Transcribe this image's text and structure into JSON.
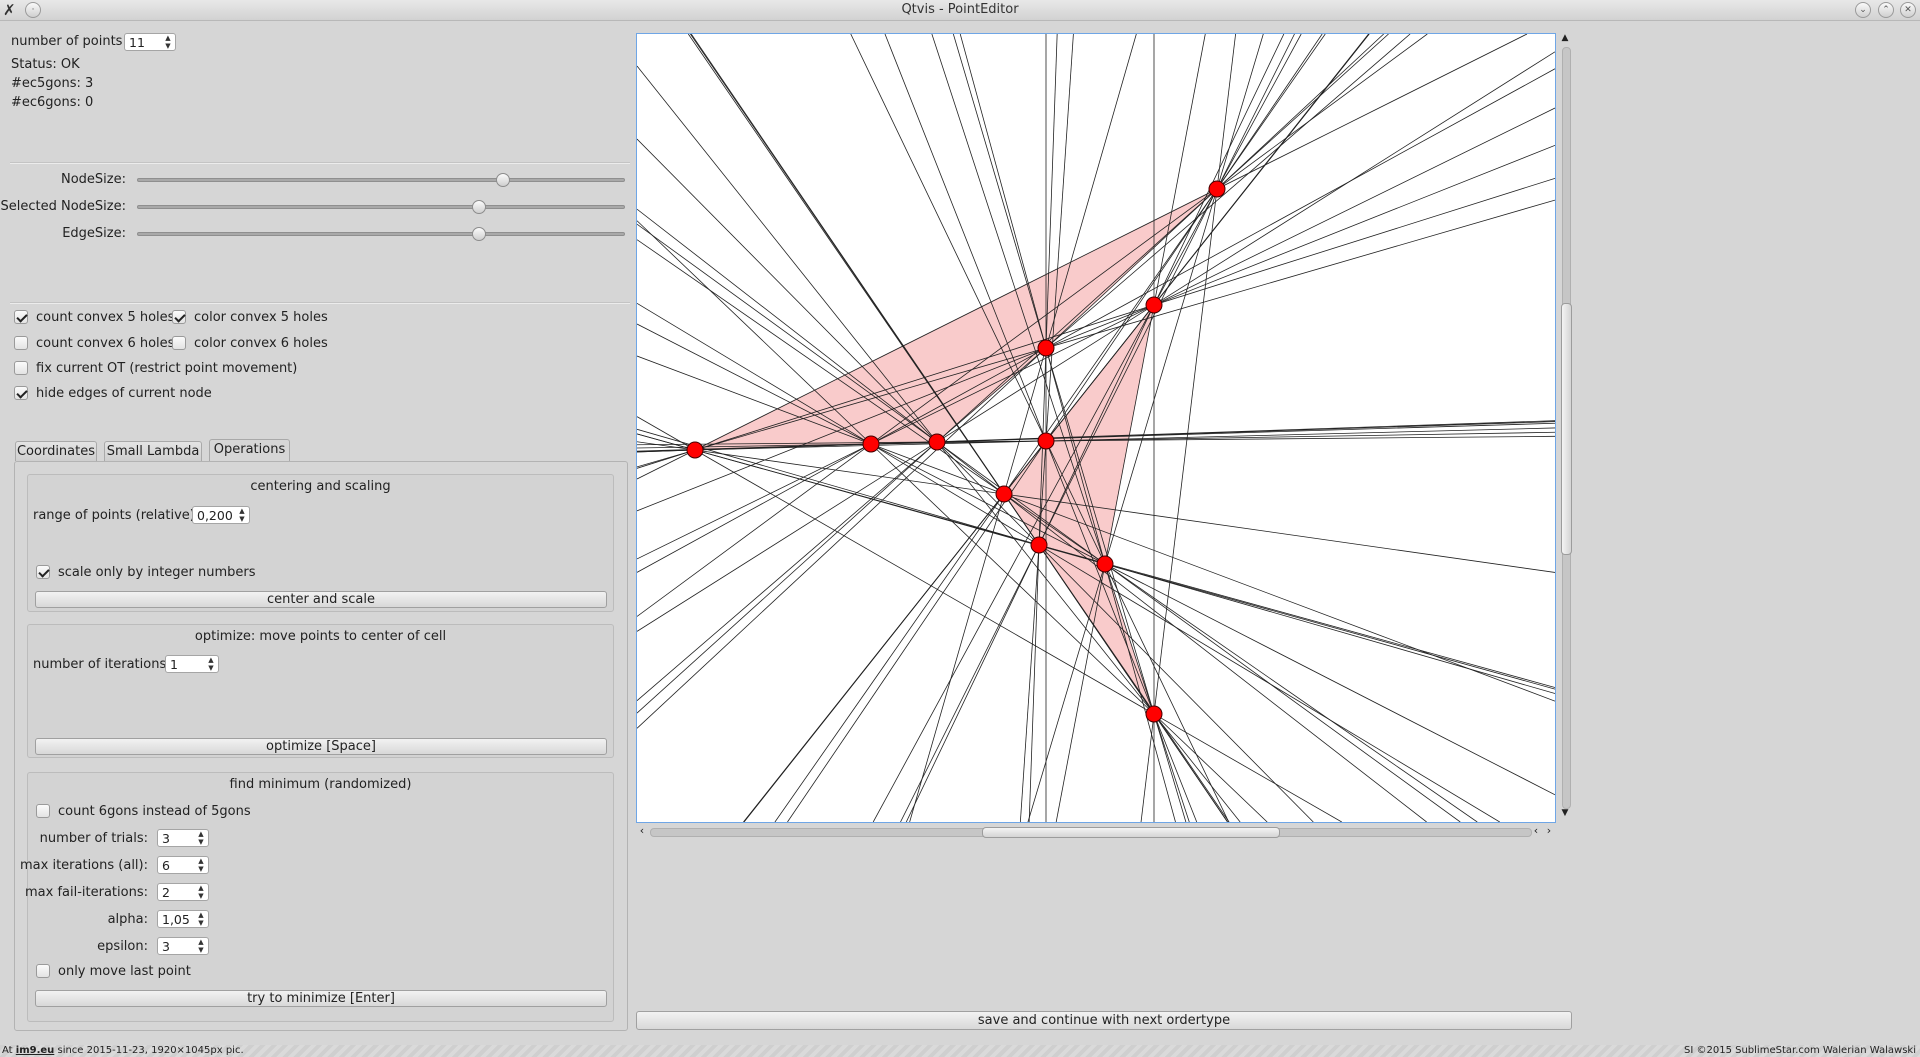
{
  "window": {
    "title": "Qtvis - PointEditor"
  },
  "info": {
    "num_points_label": "number of points:",
    "num_points_value": "11",
    "status": "Status: OK",
    "ec5": "#ec5gons: 3",
    "ec6": "#ec6gons: 0"
  },
  "sliders": [
    {
      "label": "NodeSize:",
      "level": 0.75
    },
    {
      "label": "Selected NodeSize:",
      "level": 0.7
    },
    {
      "label": "EdgeSize:",
      "level": 0.7
    }
  ],
  "options": {
    "count5": {
      "label": "count convex 5 holes",
      "checked": true
    },
    "color5": {
      "label": "color convex 5 holes",
      "checked": true
    },
    "count6": {
      "label": "count convex 6 holes",
      "checked": false
    },
    "color6": {
      "label": "color convex 6 holes",
      "checked": false
    },
    "fix_ot": {
      "label": "fix current OT (restrict point movement)",
      "checked": false
    },
    "hide_edges": {
      "label": "hide edges of current node",
      "checked": true
    }
  },
  "tabs": [
    "Coordinates",
    "Small Lambda",
    "Operations"
  ],
  "active_tab": "Operations",
  "centering": {
    "title": "centering and scaling",
    "range_label": "range of points (relative):",
    "range_value": "0,200",
    "int_label": "scale only by integer numbers",
    "int_checked": true,
    "button": "center and scale"
  },
  "optimize": {
    "title": "optimize: move points to center of cell",
    "iter_label": "number of iterations:",
    "iter_value": "1",
    "button": "optimize [Space]"
  },
  "minimum": {
    "title": "find minimum (randomized)",
    "count6_label": "count 6gons instead of 5gons",
    "count6_checked": false,
    "trials_label": "number of trials:",
    "trials_value": "3",
    "maxiter_label": "max iterations (all):",
    "maxiter_value": "6",
    "maxfail_label": "max fail-iterations:",
    "maxfail_value": "2",
    "alpha_label": "alpha:",
    "alpha_value": "1,05",
    "epsilon_label": "epsilon:",
    "epsilon_value": "3",
    "lastpoint_label": "only move last point",
    "lastpoint_checked": false,
    "button": "try to minimize [Enter]"
  },
  "save_button": "save and continue with next ordertype",
  "footer": {
    "left_prefix": "At",
    "left_site": "im9.eu",
    "left_rest": "since 2015-11-23, 1920×1045px pic.",
    "right": "SI ©2015 SublimeStar.com Walerian Walawski"
  },
  "colors": {
    "node": "#ff0000",
    "hole_fill": "#f4a0a0",
    "canvas_border": "#6fa6e6"
  }
}
